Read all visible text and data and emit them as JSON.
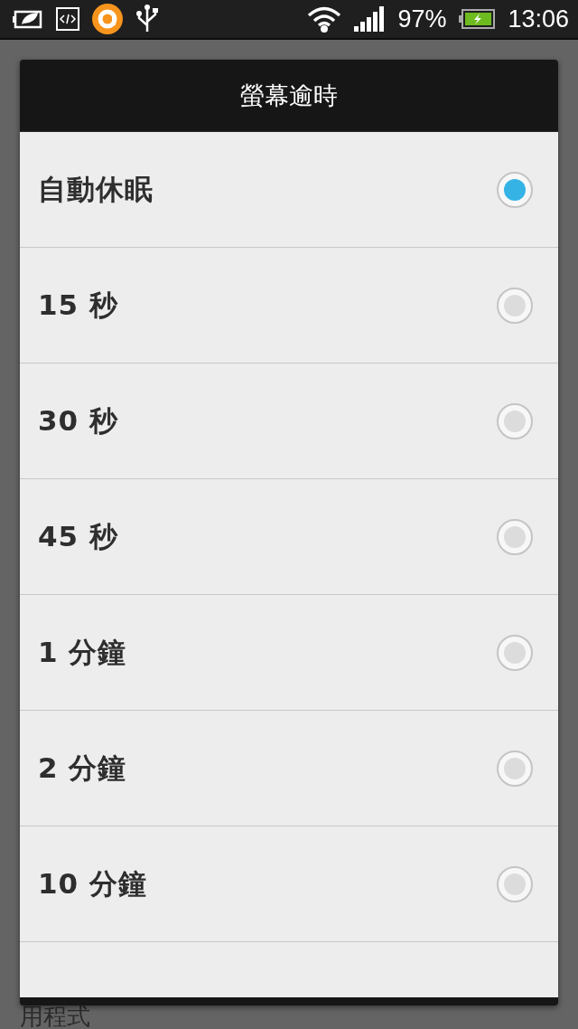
{
  "status_bar": {
    "battery_percent": "97%",
    "time": "13:06"
  },
  "dialog": {
    "title": "螢幕逾時",
    "options": [
      {
        "label": "自動休眠",
        "selected": true
      },
      {
        "label": "15 秒",
        "selected": false
      },
      {
        "label": "30 秒",
        "selected": false
      },
      {
        "label": "45 秒",
        "selected": false
      },
      {
        "label": "1 分鐘",
        "selected": false
      },
      {
        "label": "2 分鐘",
        "selected": false
      },
      {
        "label": "10 分鐘",
        "selected": false
      }
    ]
  },
  "background": {
    "text": "用程式"
  }
}
